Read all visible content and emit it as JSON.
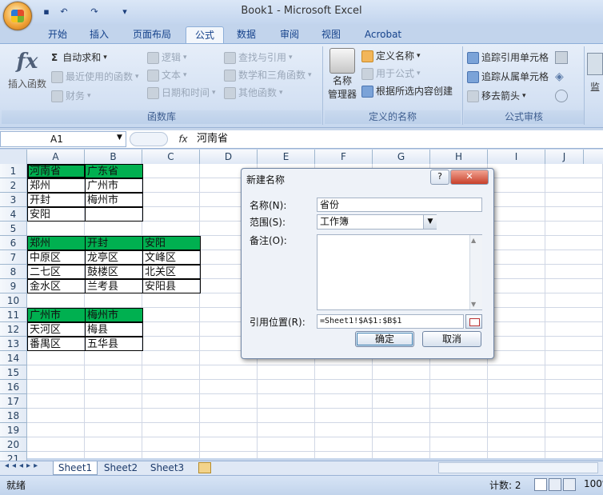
{
  "window": {
    "title": "Book1 - Microsoft Excel"
  },
  "tabs": [
    "开始",
    "插入",
    "页面布局",
    "公式",
    "数据",
    "审阅",
    "视图",
    "Acrobat"
  ],
  "ribbon": {
    "insert_function": "插入函数",
    "autosum": "自动求和",
    "recent": "最近使用的函数",
    "finance": "财务",
    "logic": "逻辑",
    "text": "文本",
    "datetime": "日期和时间",
    "lookup": "查找与引用",
    "math": "数学和三角函数",
    "more": "其他函数",
    "group_library": "函数库",
    "name_manager_1": "名称",
    "name_manager_2": "管理器",
    "define_name": "定义名称",
    "use_in_formula": "用于公式",
    "create_from_selection": "根据所选内容创建",
    "group_names": "定义的名称",
    "trace_precedents": "追踪引用单元格",
    "trace_dependents": "追踪从属单元格",
    "remove_arrows": "移去箭头",
    "group_audit": "公式审核",
    "watch": "监"
  },
  "formula_bar": {
    "name_box": "A1",
    "fx": "fx",
    "content": "河南省"
  },
  "columns": [
    "A",
    "B",
    "C",
    "D",
    "E",
    "F",
    "G",
    "H",
    "I",
    "J"
  ],
  "rows": [
    "1",
    "2",
    "3",
    "4",
    "5",
    "6",
    "7",
    "8",
    "9",
    "10",
    "11",
    "12",
    "13",
    "14",
    "15",
    "16",
    "17",
    "18",
    "19",
    "20",
    "21"
  ],
  "cells": {
    "A1": "河南省",
    "B1": "广东省",
    "A2": "郑州",
    "B2": "广州市",
    "A3": "开封",
    "B3": "梅州市",
    "A4": "安阳",
    "B4": "",
    "A6": "郑州",
    "B6": "开封",
    "C6": "安阳",
    "A7": "中原区",
    "B7": "龙亭区",
    "C7": "文峰区",
    "A8": "二七区",
    "B8": "鼓楼区",
    "C8": "北关区",
    "A9": "金水区",
    "B9": "兰考县",
    "C9": "安阳县",
    "A11": "广州市",
    "B11": "梅州市",
    "A12": "天河区",
    "B12": "梅县",
    "A13": "番禺区",
    "B13": "五华县"
  },
  "dialog": {
    "title": "新建名称",
    "help": "?",
    "close": "✕",
    "name_label": "名称(N):",
    "name_value": "省份",
    "scope_label": "范围(S):",
    "scope_value": "工作簿",
    "comment_label": "备注(O):",
    "refers_label": "引用位置(R):",
    "refers_value": "=Sheet1!$A$1:$B$1",
    "ok": "确定",
    "cancel": "取消"
  },
  "sheets": [
    "Sheet1",
    "Sheet2",
    "Sheet3"
  ],
  "status": {
    "mode": "就绪",
    "count": "计数: 2",
    "zoom": "100%"
  },
  "colors": {
    "header_fill": "#00b050",
    "ribbon_text": "#15428b"
  }
}
